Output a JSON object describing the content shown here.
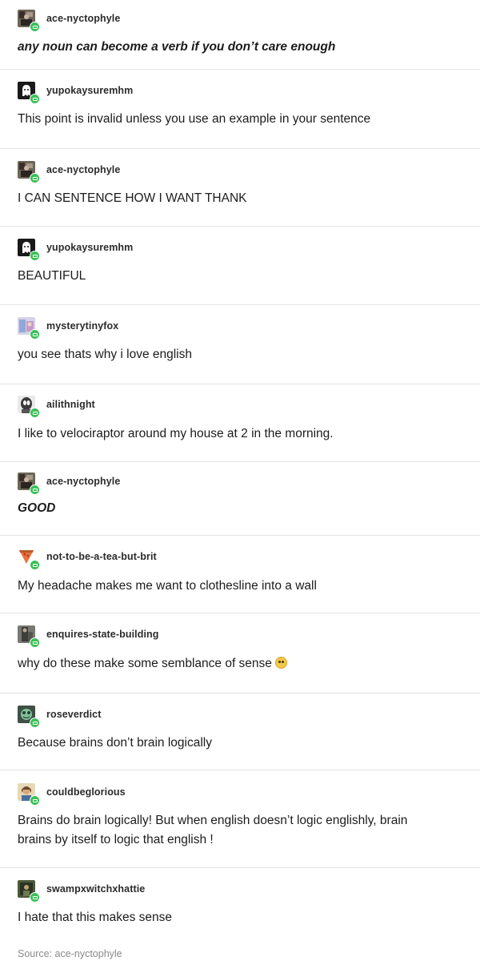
{
  "posts": [
    {
      "username": "ace-nyctophyle",
      "text": "any noun can become a verb if you don’t care enough",
      "style": "italic-bold",
      "avatar": "ace-nyctophyle-avatar"
    },
    {
      "username": "yupokaysuremhm",
      "text": "This point is invalid unless you use an example in your sentence",
      "style": "normal",
      "avatar": "ghost-avatar"
    },
    {
      "username": "ace-nyctophyle",
      "text": "I CAN SENTENCE HOW I WANT THANK",
      "style": "normal",
      "avatar": "ace-nyctophyle-avatar"
    },
    {
      "username": "yupokaysuremhm",
      "text": "BEAUTIFUL",
      "style": "normal",
      "avatar": "ghost-avatar"
    },
    {
      "username": "mysterytinyfox",
      "text": "you see thats why i love english",
      "style": "normal",
      "avatar": "mysterytinyfox-avatar"
    },
    {
      "username": "ailithnight",
      "text": "I like to velociraptor around my house at 2 in the morning.",
      "style": "normal",
      "avatar": "ailithnight-avatar"
    },
    {
      "username": "ace-nyctophyle",
      "text": "GOOD",
      "style": "italic-bold",
      "avatar": "ace-nyctophyle-avatar"
    },
    {
      "username": "not-to-be-a-tea-but-brit",
      "text": "My headache makes me want to clothesline into a wall",
      "style": "normal",
      "avatar": "pizza-slice-avatar"
    },
    {
      "username": "enquires-state-building",
      "text": "why do these make some semblance of sense",
      "style": "normal",
      "avatar": "enquires-state-building-avatar",
      "emoji": "worried-face-emoji"
    },
    {
      "username": "roseverdict",
      "text": "Because brains don’t brain logically",
      "style": "normal",
      "avatar": "roseverdict-avatar"
    },
    {
      "username": "couldbeglorious",
      "text_lines": [
        "Brains do brain logically! But when english doesn’t logic englishly, brain",
        "brains by itself to logic that english !"
      ],
      "style": "normal",
      "avatar": "couldbeglorious-avatar"
    },
    {
      "username": "swampxwitchxhattie",
      "text": "I hate that this makes sense",
      "style": "normal",
      "avatar": "swampxwitchxhattie-avatar"
    }
  ],
  "source": "Source: ace-nyctophyle",
  "colors": {
    "follow_badge": "#3bbf58",
    "divider": "#e4e4e4",
    "source_text": "#8a8a8a"
  }
}
